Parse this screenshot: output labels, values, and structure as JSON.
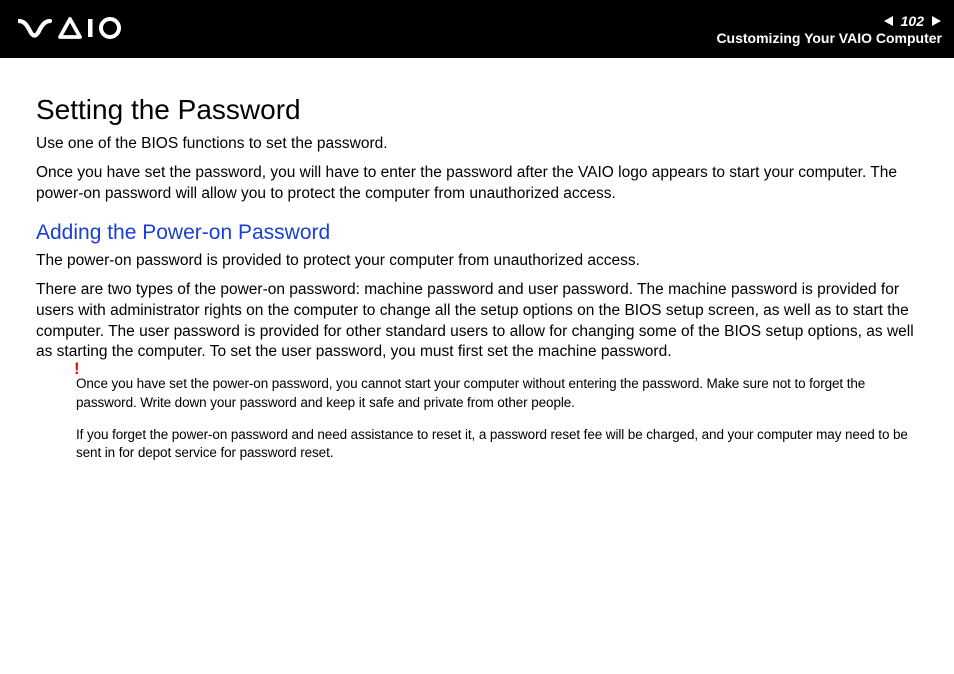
{
  "header": {
    "page_number": "102",
    "breadcrumb": "Customizing Your VAIO Computer"
  },
  "content": {
    "title": "Setting the Password",
    "intro1": "Use one of the BIOS functions to set the password.",
    "intro2": "Once you have set the password, you will have to enter the password after the VAIO logo appears to start your computer. The power-on password will allow you to protect the computer from unauthorized access.",
    "subtitle": "Adding the Power-on Password",
    "body1": "The power-on password is provided to protect your computer from unauthorized access.",
    "body2": "There are two types of the power-on password: machine password and user password. The machine password is provided for users with administrator rights on the computer to change all the setup options on the BIOS setup screen, as well as to start the computer. The user password is provided for other standard users to allow for changing some of the BIOS setup options, as well as starting the computer. To set the user password, you must first set the machine password.",
    "warning_mark": "!",
    "note1": "Once you have set the power-on password, you cannot start your computer without entering the password. Make sure not to forget the password. Write down your password and keep it safe and private from other people.",
    "note2": "If you forget the power-on password and need assistance to reset it, a password reset fee will be charged, and your computer may need to be sent in for depot service for password reset."
  }
}
